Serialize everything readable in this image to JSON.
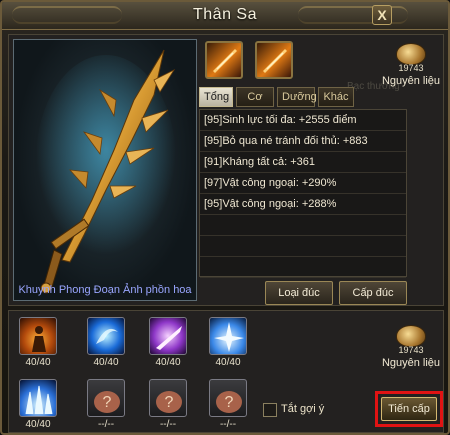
{
  "window": {
    "title": "Thân Sa",
    "close_glyph": "X"
  },
  "weapon": {
    "name": "Khuynh Phong Đoạn Ảnh phồn hoa",
    "icon": "dragon-sword"
  },
  "material_top": {
    "count": "19743",
    "label": "Nguyên liệu"
  },
  "ghost_hint": "Bạc thường",
  "tabs": [
    "Tổng",
    "Cơ sở",
    "Dưỡng",
    "Khác"
  ],
  "active_tab": "Tổng",
  "stats": [
    "[95]Sinh lực tối đa: +2555 điểm",
    "[95]Bỏ qua né tránh đối thủ: +883",
    "[91]Kháng tất cả: +361",
    "[97]Vật công ngoại: +290%",
    "[95]Vật công ngoại: +288%"
  ],
  "buttons": {
    "filter": "Loại đúc",
    "upgrade_cast": "Cấp đúc",
    "advance": "Tiến cấp"
  },
  "skills": [
    {
      "count": "40/40",
      "icon": "warrior-aura"
    },
    {
      "count": "40/40",
      "icon": "blue-vortex"
    },
    {
      "count": "40/40",
      "icon": "purple-slash"
    },
    {
      "count": "40/40",
      "icon": "ice-burst"
    },
    {
      "count": "40/40",
      "icon": "ice-spikes"
    },
    {
      "count": "--/--",
      "icon": "unknown-bag"
    },
    {
      "count": "--/--",
      "icon": "unknown-bag"
    },
    {
      "count": "--/--",
      "icon": "unknown-bag"
    }
  ],
  "material_bottom": {
    "count": "19743",
    "label": "Nguyên liệu"
  },
  "checkbox_label": "Tắt gợi ý",
  "colors": {
    "accent_red": "#e01313",
    "caption_blue": "#9aa6ff",
    "gold_border": "#9a8756"
  }
}
